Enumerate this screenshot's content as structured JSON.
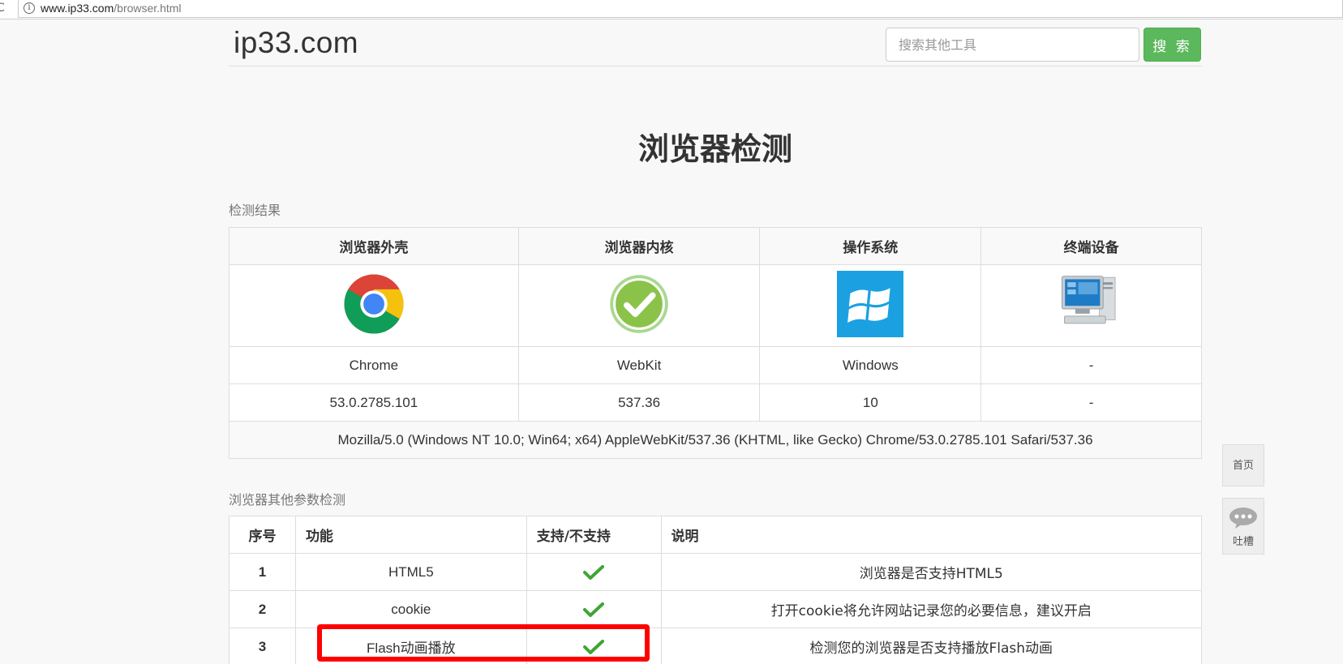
{
  "browser": {
    "url_host": "www.ip33.com",
    "url_path": "/browser.html"
  },
  "header": {
    "logo": "ip33.com",
    "search_placeholder": "搜索其他工具",
    "search_button": "搜 索"
  },
  "page_title": "浏览器检测",
  "result_section": {
    "label": "检测结果",
    "columns": [
      "浏览器外壳",
      "浏览器内核",
      "操作系统",
      "终端设备"
    ],
    "icons": [
      "chrome-logo",
      "webkit-check",
      "windows-logo",
      "desktop-computer"
    ],
    "names": [
      "Chrome",
      "WebKit",
      "Windows",
      "-"
    ],
    "versions": [
      "53.0.2785.101",
      "537.36",
      "10",
      "-"
    ],
    "user_agent": "Mozilla/5.0 (Windows NT 10.0; Win64; x64) AppleWebKit/537.36 (KHTML, like Gecko) Chrome/53.0.2785.101 Safari/537.36"
  },
  "params_section": {
    "label": "浏览器其他参数检测",
    "columns": [
      "序号",
      "功能",
      "支持/不支持",
      "说明"
    ],
    "rows": [
      {
        "num": "1",
        "feature": "HTML5",
        "supported": "check-mark",
        "desc": "浏览器是否支持HTML5"
      },
      {
        "num": "2",
        "feature": "cookie",
        "supported": "check-mark",
        "desc": "打开cookie将允许网站记录您的必要信息，建议开启"
      },
      {
        "num": "3",
        "feature": "Flash动画播放",
        "supported": "check-mark",
        "desc": "检测您的浏览器是否支持播放Flash动画"
      }
    ]
  },
  "side": {
    "home": "首页",
    "feedback": "吐槽"
  },
  "colors": {
    "search_button": "#5cb85c",
    "highlight_box": "#ff0000"
  }
}
